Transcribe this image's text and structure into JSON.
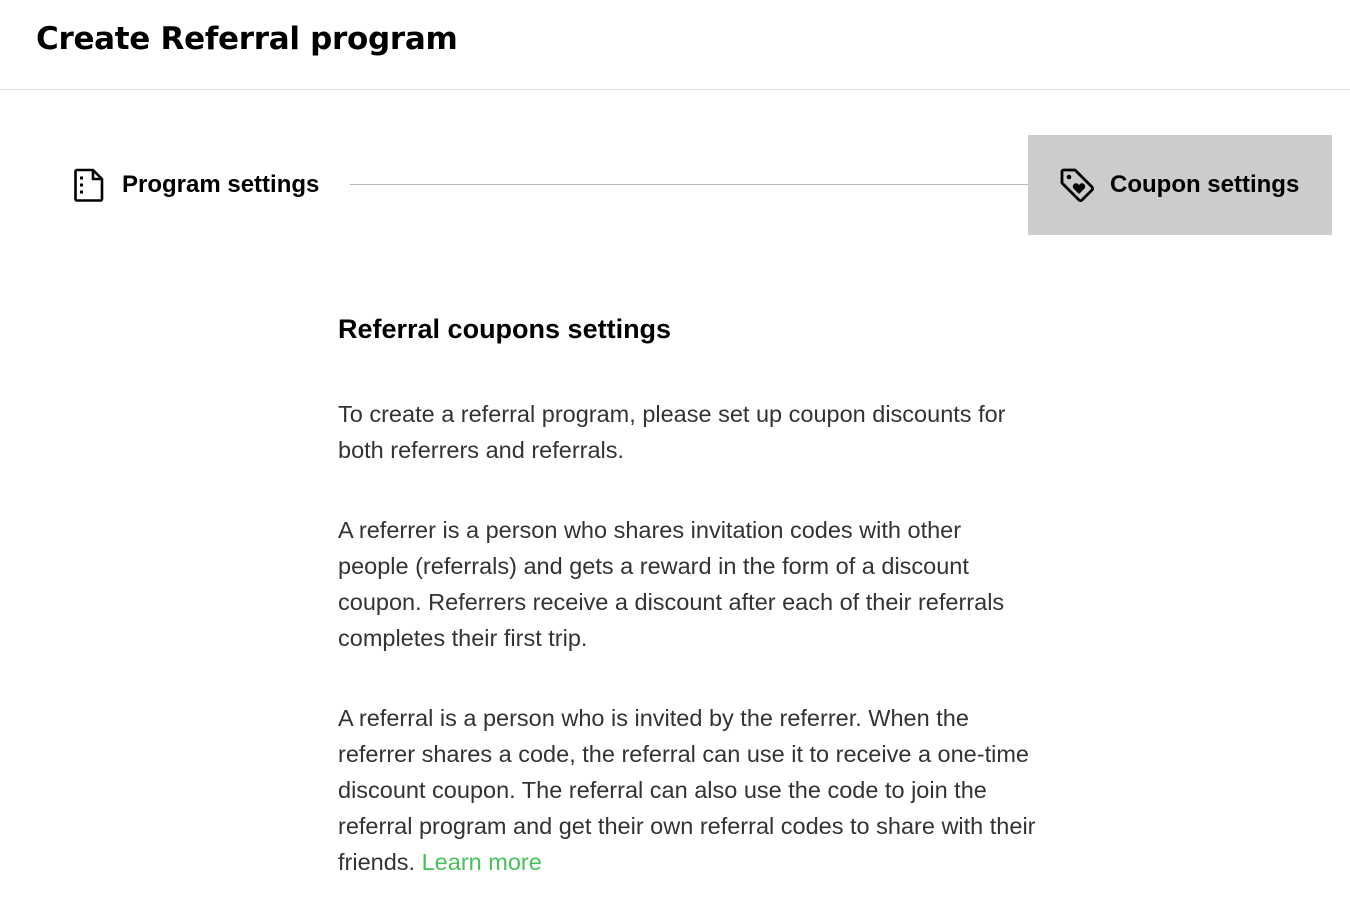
{
  "header": {
    "title": "Create Referral program"
  },
  "stepper": {
    "steps": [
      {
        "label": "Program settings",
        "icon": "document-icon",
        "active": false
      },
      {
        "label": "Coupon settings",
        "icon": "tag-heart-icon",
        "active": true
      }
    ]
  },
  "main": {
    "section_title": "Referral coupons settings",
    "paragraphs": [
      "To create a referral program, please set up coupon discounts for both referrers and referrals.",
      "A referrer is a person who shares invitation codes with other people (referrals) and gets a reward in the form of a discount coupon. Referrers receive a discount after each of their referrals completes their first trip.",
      "A referral is a person who is invited by the referrer. When the referrer shares a code, the referral can use it to receive a one-time discount coupon. The referral can also use the code to join the referral program and get their own referral codes to share with their friends."
    ],
    "learn_more_label": "Learn more"
  },
  "colors": {
    "active_step_bg": "#cccccc",
    "link": "#47c15a",
    "body_text": "#333333",
    "divider": "#e2e2e2"
  }
}
